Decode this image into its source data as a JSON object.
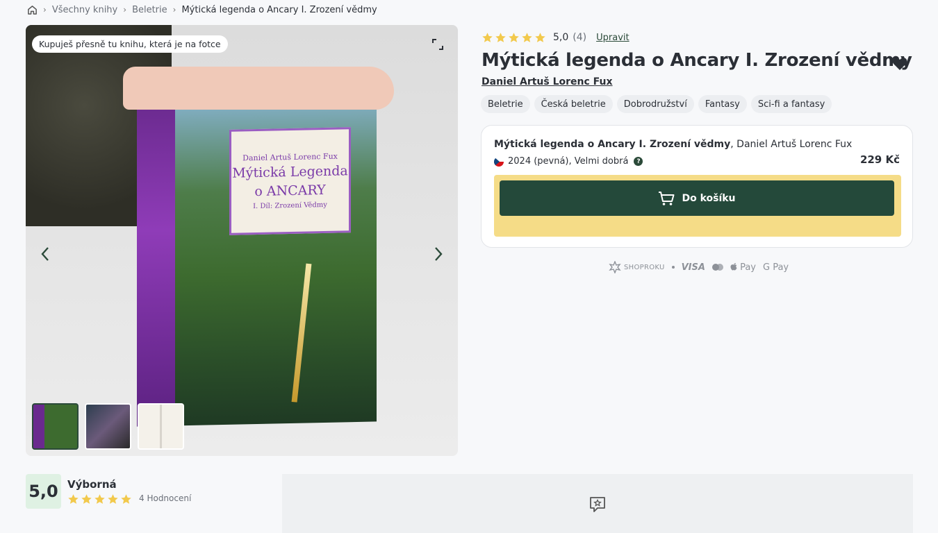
{
  "breadcrumb": {
    "items": [
      "Všechny knihy",
      "Beletrie"
    ],
    "current": "Mýtická legenda o Ancary I. Zrození vědmy"
  },
  "gallery": {
    "badge": "Kupuješ přesně tu knihu, která je na fotce",
    "cover_author": "Daniel Artuš Lorenc Fux",
    "cover_title_line1": "Mýtická Legenda",
    "cover_title_line2": "o ANCARY",
    "cover_subtitle": "I. Díl: Zrození Vědmy",
    "thumbnail_count": 3,
    "active_thumbnail": 1
  },
  "product": {
    "rating_value": "5,0",
    "rating_count": "(4)",
    "rating_stars": 5,
    "edit_label": "Upravit",
    "title": "Mýtická legenda o Ancary I. Zrození vědmy",
    "author": "Daniel Artuš Lorenc Fux",
    "tags": [
      "Beletrie",
      "Česká beletrie",
      "Dobrodružství",
      "Fantasy",
      "Sci-fi a fantasy"
    ]
  },
  "offer": {
    "title": "Mýtická legenda o Ancary I. Zrození vědmy",
    "author_suffix": ", Daniel Artuš Lorenc Fux",
    "meta": "2024 (pevná), Velmi dobrá",
    "price": "229 Kč",
    "cart_label": "Do košíku",
    "help_symbol": "?"
  },
  "payments": {
    "shoproku": "SHOPROKU",
    "visa": "VISA",
    "apple_pay": "Pay",
    "google_pay": "G Pay"
  },
  "reviews": {
    "score": "5,0",
    "label": "Výborná",
    "count": "4 Hodnocení",
    "stars": 5
  },
  "colors": {
    "accent": "#24493a",
    "cart_area": "#f5dc87",
    "star": "#f2c94c",
    "score_bg": "#dff1e3"
  }
}
